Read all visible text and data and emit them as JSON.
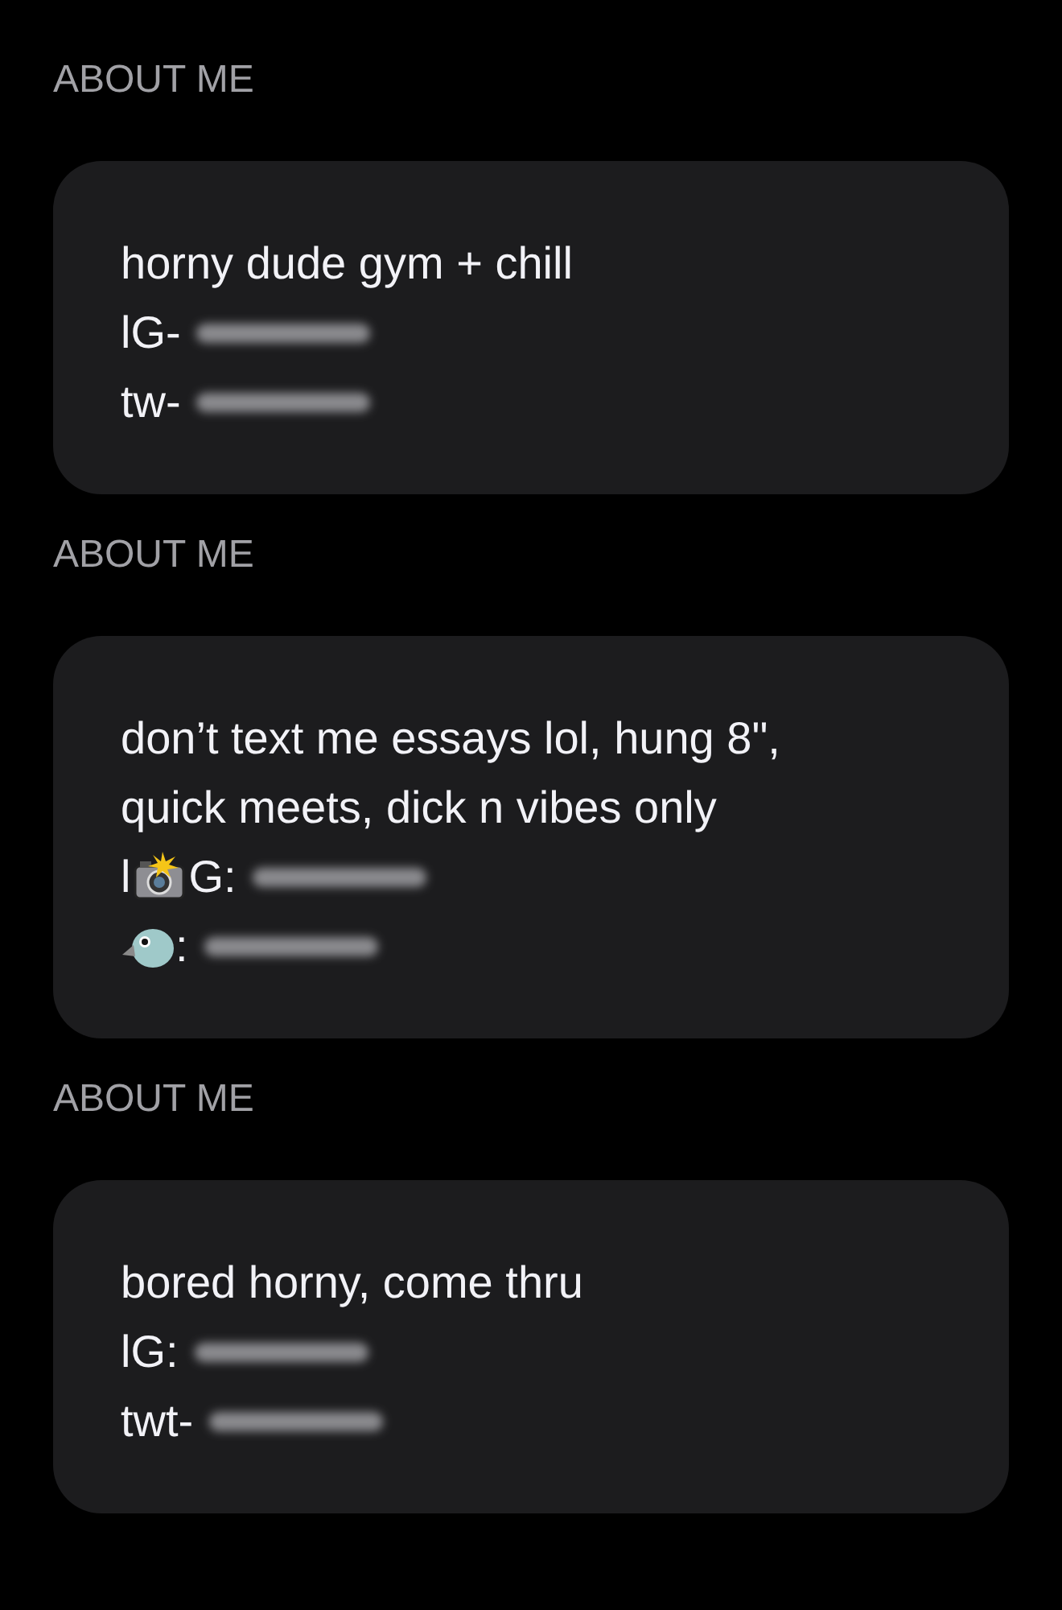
{
  "sections": [
    {
      "heading": "ABOUT ME",
      "lines": [
        [
          {
            "kind": "text",
            "text": "horny dude gym + chill"
          }
        ],
        [
          {
            "kind": "text",
            "text": "lG-"
          },
          {
            "kind": "redacted"
          }
        ],
        [
          {
            "kind": "text",
            "text": "tw-"
          },
          {
            "kind": "redacted"
          }
        ]
      ]
    },
    {
      "heading": "ABOUT ME",
      "lines": [
        [
          {
            "kind": "text",
            "text": "don’t text me essays lol, hung 8\","
          }
        ],
        [
          {
            "kind": "text",
            "text": "quick meets, dick n vibes only"
          }
        ],
        [
          {
            "kind": "text",
            "text": "l"
          },
          {
            "kind": "camera"
          },
          {
            "kind": "text",
            "text": "G:"
          },
          {
            "kind": "redacted"
          }
        ],
        [
          {
            "kind": "bird"
          },
          {
            "kind": "text",
            "text": ":"
          },
          {
            "kind": "redacted"
          }
        ]
      ]
    },
    {
      "heading": "ABOUT ME",
      "lines": [
        [
          {
            "kind": "text",
            "text": "bored horny, come thru"
          }
        ],
        [
          {
            "kind": "text",
            "text": "lG:"
          },
          {
            "kind": "redacted"
          }
        ],
        [
          {
            "kind": "text",
            "text": "twt-"
          },
          {
            "kind": "redacted"
          }
        ]
      ]
    }
  ]
}
